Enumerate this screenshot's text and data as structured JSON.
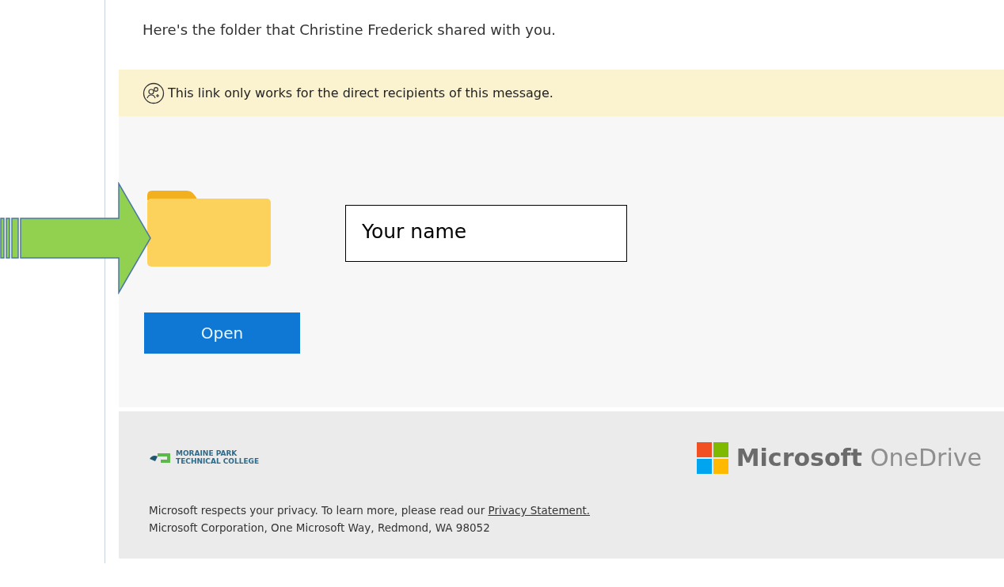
{
  "message": {
    "intro": "Here's the folder that Christine Frederick shared with you."
  },
  "notice": {
    "text": "This link only works for the direct recipients of this message."
  },
  "annotation": {
    "text": "Your name"
  },
  "open_button": {
    "label": "Open"
  },
  "footer": {
    "college_logo": [
      "MORAINE PARK",
      "TECHNICAL COLLEGE"
    ],
    "brand": [
      "Microsoft",
      "OneDrive"
    ],
    "privacy_text": "Microsoft respects your privacy. To learn more, please read our ",
    "privacy_link": "Privacy Statement.",
    "address": "Microsoft Corporation, One Microsoft Way, Redmond, WA 98052"
  }
}
